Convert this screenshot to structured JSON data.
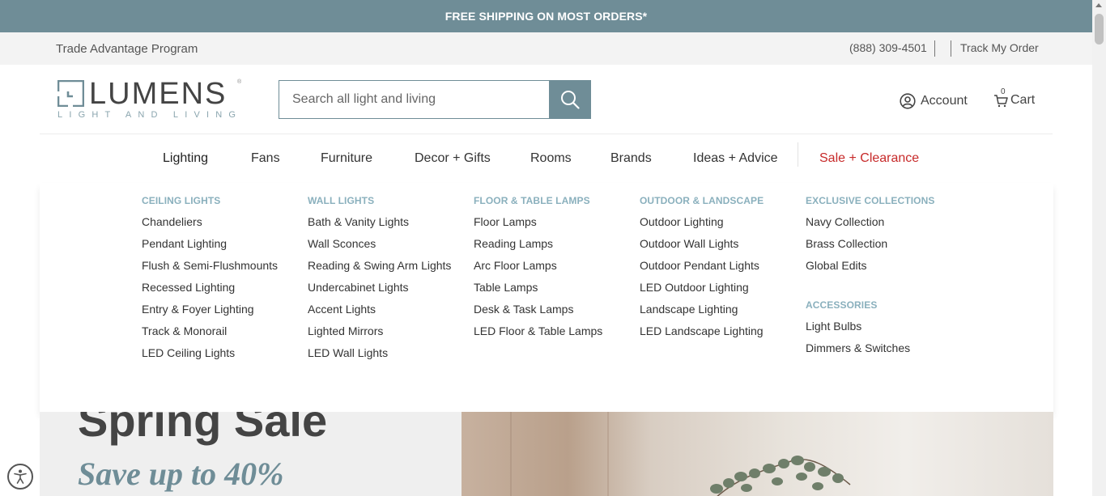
{
  "promo": {
    "text": "FREE SHIPPING ON MOST ORDERS*"
  },
  "utility": {
    "trade": "Trade Advantage Program",
    "phone": "(888) 309-4501",
    "track": "Track My Order"
  },
  "logo": {
    "word": "LUMENS",
    "reg": "®",
    "sub": "LIGHT AND LIVING"
  },
  "search": {
    "placeholder": "Search all light and living"
  },
  "account": {
    "label": "Account"
  },
  "cart": {
    "label": "Cart",
    "count": "0"
  },
  "nav": {
    "items": [
      "Lighting",
      "Fans",
      "Furniture",
      "Decor + Gifts",
      "Rooms",
      "Brands",
      "Ideas + Advice",
      "Sale + Clearance"
    ]
  },
  "mega": {
    "columns": [
      {
        "heading": "CEILING LIGHTS",
        "links": [
          "Chandeliers",
          "Pendant Lighting",
          "Flush & Semi-Flushmounts",
          "Recessed Lighting",
          "Entry & Foyer Lighting",
          "Track & Monorail",
          "LED Ceiling Lights"
        ]
      },
      {
        "heading": "WALL LIGHTS",
        "links": [
          "Bath & Vanity Lights",
          "Wall Sconces",
          "Reading & Swing Arm Lights",
          "Undercabinet Lights",
          "Accent Lights",
          "Lighted Mirrors",
          "LED Wall Lights"
        ]
      },
      {
        "heading": "FLOOR & TABLE LAMPS",
        "links": [
          "Floor Lamps",
          "Reading Lamps",
          "Arc Floor Lamps",
          "Table Lamps",
          "Desk & Task Lamps",
          "LED Floor & Table Lamps"
        ]
      },
      {
        "heading": "OUTDOOR & LANDSCAPE",
        "links": [
          "Outdoor Lighting",
          "Outdoor Wall Lights",
          "Outdoor Pendant Lights",
          "LED Outdoor Lighting",
          "Landscape Lighting",
          "LED Landscape Lighting"
        ]
      },
      {
        "heading": "EXCLUSIVE COLLECTIONS",
        "links": [
          "Navy Collection",
          "Brass Collection",
          "Global Edits"
        ],
        "heading2": "ACCESSORIES",
        "links2": [
          "Light Bulbs",
          "Dimmers & Switches"
        ]
      }
    ]
  },
  "hero": {
    "title": "Spring Sale",
    "subtitle": "Save up to 40%"
  },
  "colors": {
    "brand": "#6f8d97",
    "heading": "#8ab0bd",
    "sale": "#c72a2a"
  }
}
